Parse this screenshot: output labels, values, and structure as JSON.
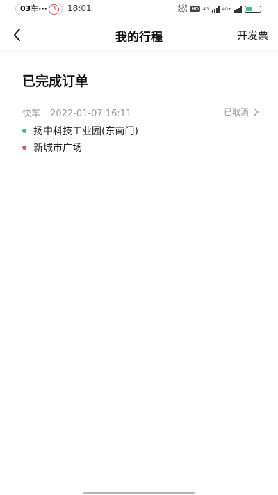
{
  "status_bar": {
    "notification_text": "03车···",
    "notification_badge": "3",
    "time": "18:01",
    "net_speed": "4.50",
    "net_speed_unit": "KB/s",
    "hd_label": "HD",
    "net1": "4G",
    "net2": "4G+",
    "battery_color": "#3cc48a"
  },
  "header": {
    "back_icon": "chevron-left-icon",
    "title": "我的行程",
    "invoice_label": "开发票"
  },
  "section": {
    "title": "已完成订单"
  },
  "orders": [
    {
      "type": "快车",
      "datetime": "2022-01-07 16:11",
      "status": "已取消",
      "start": "扬中科技工业园(东南门)",
      "end": "新城市广场",
      "start_dot_color": "#3cc48a",
      "end_dot_color": "#e5505a"
    }
  ]
}
